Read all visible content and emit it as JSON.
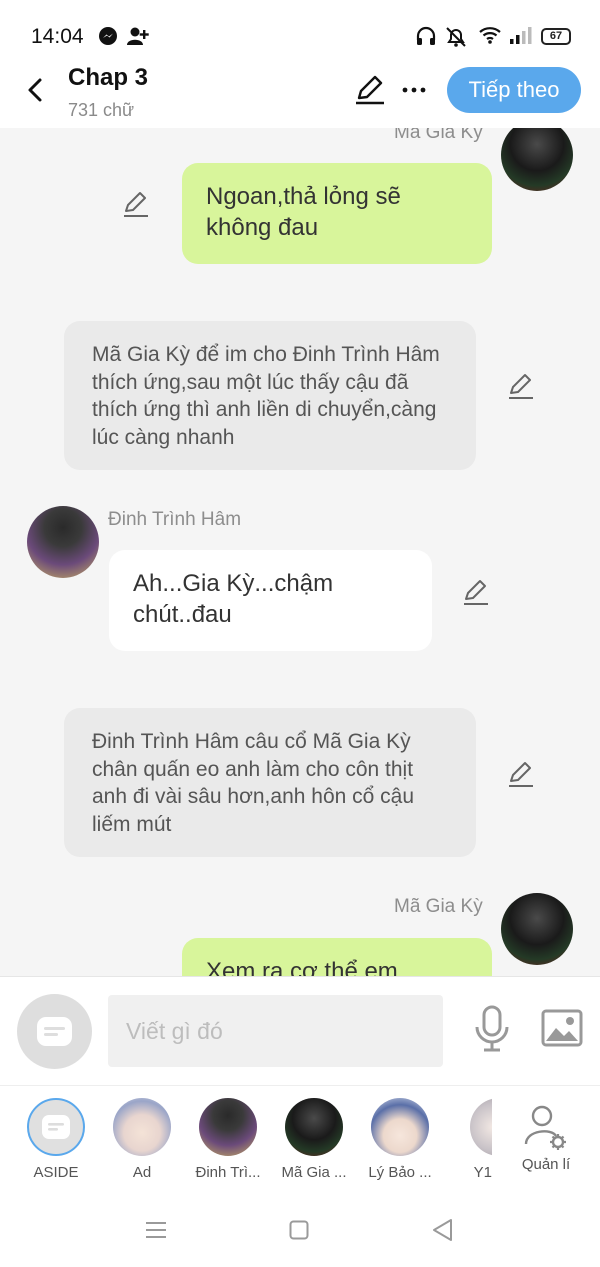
{
  "status_bar": {
    "time": "14:04",
    "battery": "67"
  },
  "header": {
    "title": "Chap 3",
    "word_count": "731 chữ",
    "next_label": "Tiếp theo"
  },
  "messages": [
    {
      "type": "right",
      "name": "Mã Gia Kỳ",
      "text": "Ngoan,thả lỏng sẽ không đau"
    },
    {
      "type": "narration",
      "text": "Mã Gia Kỳ để im cho Đinh Trình Hâm thích ứng,sau một lúc thấy cậu đã thích ứng thì anh liền di chuyển,càng lúc càng nhanh"
    },
    {
      "type": "left",
      "name": "Đinh Trình Hâm",
      "text": "Ah...Gia Kỳ...chậm chút..đau"
    },
    {
      "type": "narration",
      "text": "Đinh Trình Hâm câu cổ Mã Gia Kỳ chân quấn eo anh làm cho côn thịt anh đi vài sâu hơn,anh hôn cổ cậu liếm mút"
    },
    {
      "type": "right",
      "name": "Mã Gia Kỳ",
      "text": "Xem ra cơ thể em"
    }
  ],
  "input": {
    "placeholder": "Viết gì đó"
  },
  "characters": [
    {
      "label": "ASIDE",
      "icon": "aside-icon"
    },
    {
      "label": "Ad"
    },
    {
      "label": "Đinh Trì..."
    },
    {
      "label": "Mã Gia ..."
    },
    {
      "label": "Lý Bảo ..."
    },
    {
      "label": "Y1"
    },
    {
      "label": "Quản lí",
      "icon": "manage-user-icon"
    }
  ],
  "colors": {
    "accent": "#5aa8ec",
    "green_bubble": "#d8f59b",
    "narration_bubble": "#eaeaea"
  }
}
